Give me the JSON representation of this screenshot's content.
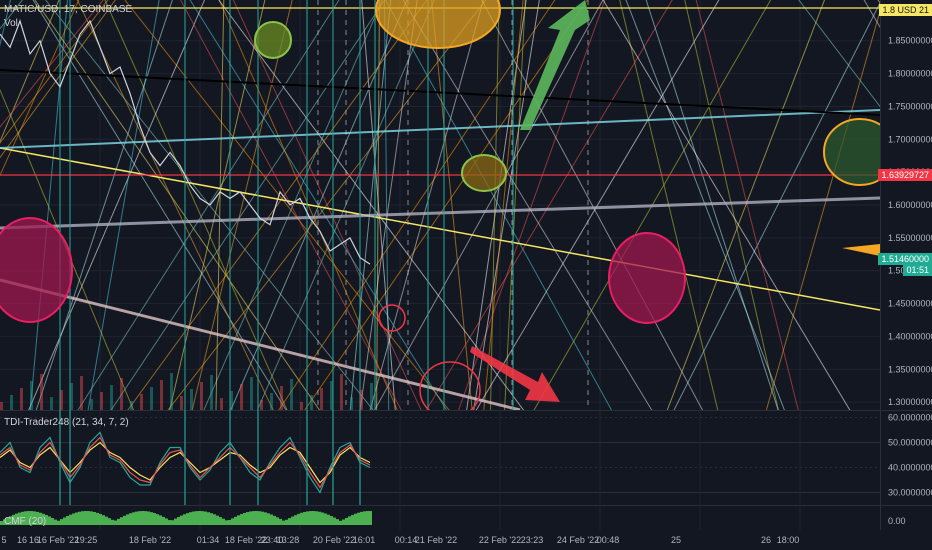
{
  "header": {
    "symbol_line": "MATIC/USD, 17, COINBASE",
    "volume_label": "Vol",
    "tdi_label": "TDI-Trader248 (21, 34, 7, 2)",
    "cmf_label": "CMF (20)"
  },
  "price_tags": {
    "top": {
      "text": "1.8 USD 21",
      "bg": "#f5e663",
      "fg": "#131722"
    },
    "red": {
      "text": "1.63929727",
      "bg": "#f23645",
      "fg": "#ffffff"
    },
    "current": {
      "text": "1.51460000",
      "bg": "#22ab94",
      "fg": "#ffffff"
    },
    "current_time": {
      "text": "01:51",
      "bg": "#22ab94",
      "fg": "#ffffff"
    }
  },
  "chart_data": {
    "type": "line",
    "price_axis": {
      "ticks": [
        "1.85000000",
        "1.80000000",
        "1.75000000",
        "1.70000000",
        "1.65000000",
        "1.60000000",
        "1.55000000",
        "1.50000000",
        "1.45000000",
        "1.40000000",
        "1.35000000",
        "1.30000000"
      ],
      "tick_values": [
        1.85,
        1.8,
        1.75,
        1.7,
        1.65,
        1.6,
        1.55,
        1.5,
        1.45,
        1.4,
        1.35,
        1.3
      ],
      "ylim": [
        1.288,
        1.912
      ]
    },
    "tdi_axis": {
      "ticks": [
        "60.00000000",
        "50.00000000",
        "40.00000000",
        "30.00000000"
      ],
      "tick_values": [
        60,
        50,
        40,
        30
      ],
      "ylim": [
        25,
        63
      ]
    },
    "cmf_axis": {
      "ticks": [
        "0.00"
      ],
      "tick_values": [
        0
      ]
    },
    "time_axis": {
      "labels": [
        "5",
        "16",
        "16",
        "16 Feb '22",
        "19:25",
        "18 Feb '22",
        "01:34",
        "18 Feb '22",
        "23:40",
        "13:28",
        "20 Feb '22",
        "16:01",
        "00:14",
        "21 Feb '22",
        "22 Feb '22",
        "23:23",
        "24 Feb '22",
        "00:48",
        "25",
        "26",
        "18:00"
      ]
    },
    "price_series": {
      "name": "",
      "x": [
        0,
        10,
        20,
        30,
        40,
        50,
        60,
        70,
        80,
        90,
        100,
        110,
        120,
        130,
        140,
        150,
        160,
        170,
        180,
        190,
        200,
        210,
        220,
        230,
        240,
        250,
        260,
        270,
        280,
        290,
        300,
        310,
        320,
        330,
        340,
        350,
        360,
        370
      ],
      "values": [
        1.86,
        1.84,
        1.88,
        1.83,
        1.85,
        1.8,
        1.78,
        1.82,
        1.86,
        1.88,
        1.84,
        1.8,
        1.81,
        1.77,
        1.72,
        1.68,
        1.66,
        1.68,
        1.66,
        1.63,
        1.61,
        1.6,
        1.62,
        1.61,
        1.62,
        1.6,
        1.58,
        1.57,
        1.62,
        1.6,
        1.61,
        1.58,
        1.56,
        1.53,
        1.54,
        1.55,
        1.52,
        1.51
      ]
    },
    "tdi_series": [
      {
        "name": "",
        "color": "#f5e663",
        "values": [
          44,
          47,
          42,
          40,
          45,
          48,
          43,
          38,
          42,
          47,
          50,
          46,
          44,
          40,
          37,
          35,
          40,
          44,
          46,
          42,
          38,
          40,
          43,
          46,
          45,
          41,
          38,
          40,
          45,
          48,
          46,
          40,
          34,
          38,
          45,
          48,
          44,
          42
        ]
      },
      {
        "name": "",
        "color": "#26a69a",
        "values": [
          46,
          50,
          40,
          38,
          48,
          52,
          42,
          34,
          40,
          50,
          54,
          44,
          42,
          36,
          33,
          33,
          42,
          48,
          48,
          40,
          35,
          39,
          46,
          50,
          44,
          38,
          35,
          42,
          48,
          52,
          44,
          36,
          30,
          40,
          48,
          50,
          42,
          40
        ]
      },
      {
        "name": "",
        "color": "#ef5350",
        "values": [
          45,
          48,
          41,
          39,
          46,
          50,
          43,
          36,
          41,
          48,
          52,
          45,
          43,
          38,
          35,
          34,
          41,
          46,
          47,
          41,
          36,
          40,
          44,
          48,
          44,
          40,
          36,
          41,
          46,
          50,
          45,
          38,
          32,
          39,
          46,
          49,
          43,
          41
        ]
      }
    ],
    "circles": [
      {
        "label": "",
        "color": "#f5a623"
      },
      {
        "label": "",
        "color": "#8bc34a"
      },
      {
        "label": "",
        "color": "#8bc34a"
      },
      {
        "label": "",
        "color": "#e91e63"
      },
      {
        "label": "",
        "color": "#e91e63"
      },
      {
        "label": "",
        "color": "#f5a623"
      }
    ],
    "grid": true
  }
}
